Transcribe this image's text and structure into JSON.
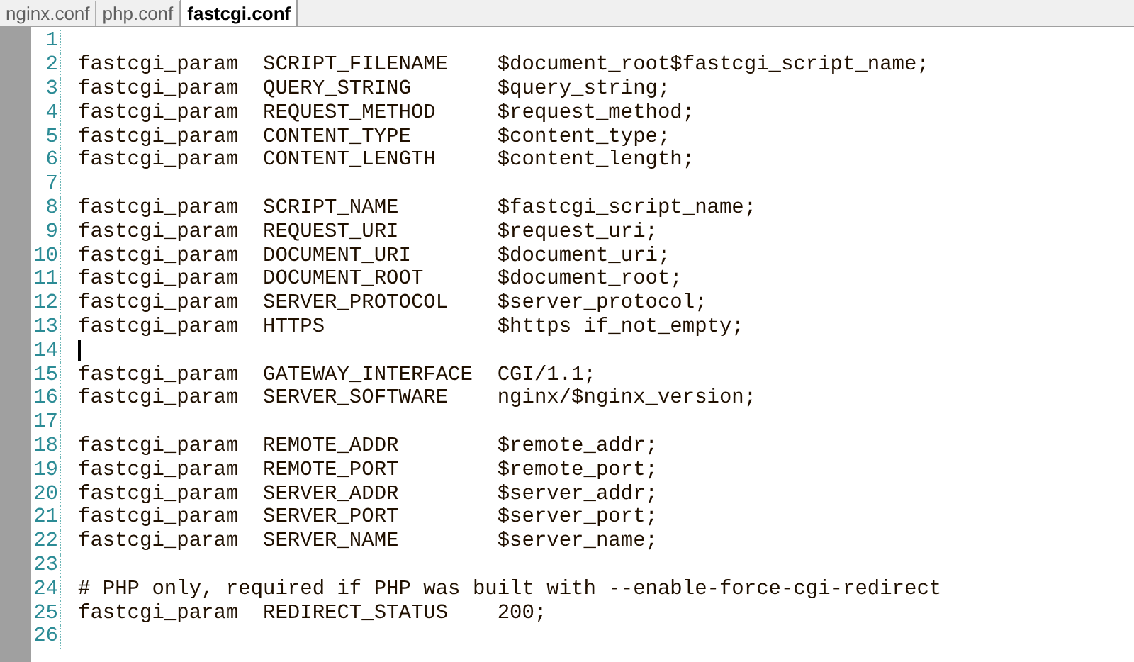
{
  "tabs": [
    {
      "label": "nginx.conf",
      "selected": false
    },
    {
      "label": "php.conf",
      "selected": false
    },
    {
      "label": "fastcgi.conf",
      "selected": true
    }
  ],
  "lines": [
    {
      "number": "1",
      "cursor": false
    },
    {
      "number": "2",
      "text": "fastcgi_param  SCRIPT_FILENAME    $document_root$fastcgi_script_name;",
      "cursor": false
    },
    {
      "number": "3",
      "text": "fastcgi_param  QUERY_STRING       $query_string;",
      "cursor": false
    },
    {
      "number": "4",
      "text": "fastcgi_param  REQUEST_METHOD     $request_method;",
      "cursor": false
    },
    {
      "number": "5",
      "text": "fastcgi_param  CONTENT_TYPE       $content_type;",
      "cursor": false
    },
    {
      "number": "6",
      "text": "fastcgi_param  CONTENT_LENGTH     $content_length;",
      "cursor": false
    },
    {
      "number": "7",
      "cursor": false
    },
    {
      "number": "8",
      "text": "fastcgi_param  SCRIPT_NAME        $fastcgi_script_name;",
      "cursor": false
    },
    {
      "number": "9",
      "text": "fastcgi_param  REQUEST_URI        $request_uri;",
      "cursor": false
    },
    {
      "number": "10",
      "text": "fastcgi_param  DOCUMENT_URI       $document_uri;",
      "cursor": false
    },
    {
      "number": "11",
      "text": "fastcgi_param  DOCUMENT_ROOT      $document_root;",
      "cursor": false
    },
    {
      "number": "12",
      "text": "fastcgi_param  SERVER_PROTOCOL    $server_protocol;",
      "cursor": false
    },
    {
      "number": "13",
      "text": "fastcgi_param  HTTPS              $https if_not_empty;",
      "cursor": false
    },
    {
      "number": "14",
      "cursor": true
    },
    {
      "number": "15",
      "text": "fastcgi_param  GATEWAY_INTERFACE  CGI/1.1;",
      "cursor": false
    },
    {
      "number": "16",
      "text": "fastcgi_param  SERVER_SOFTWARE    nginx/$nginx_version;",
      "cursor": false
    },
    {
      "number": "17",
      "cursor": false
    },
    {
      "number": "18",
      "text": "fastcgi_param  REMOTE_ADDR        $remote_addr;",
      "cursor": false
    },
    {
      "number": "19",
      "text": "fastcgi_param  REMOTE_PORT        $remote_port;",
      "cursor": false
    },
    {
      "number": "20",
      "text": "fastcgi_param  SERVER_ADDR        $server_addr;",
      "cursor": false
    },
    {
      "number": "21",
      "text": "fastcgi_param  SERVER_PORT        $server_port;",
      "cursor": false
    },
    {
      "number": "22",
      "text": "fastcgi_param  SERVER_NAME        $server_name;",
      "cursor": false
    },
    {
      "number": "23",
      "cursor": false
    },
    {
      "number": "24",
      "text": "# PHP only, required if PHP was built with --enable-force-cgi-redirect",
      "cursor": false
    },
    {
      "number": "25",
      "text": "fastcgi_param  REDIRECT_STATUS    200;",
      "cursor": false
    },
    {
      "number": "26",
      "cursor": false
    }
  ]
}
